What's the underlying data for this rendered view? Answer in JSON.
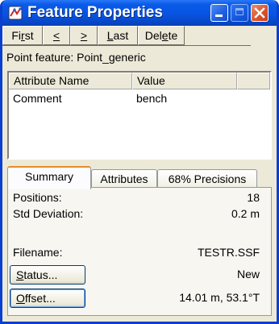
{
  "window": {
    "title": "Feature Properties",
    "icon": "feature-properties-app-icon",
    "controls": [
      "minimize-icon",
      "maximize-icon",
      "close-icon"
    ]
  },
  "nav": {
    "first": {
      "pre": "Fi",
      "key": "r",
      "post": "st"
    },
    "prev": {
      "pre": " ",
      "key": "<",
      "post": " "
    },
    "next": {
      "pre": " ",
      "key": ">",
      "post": " "
    },
    "last": {
      "pre": "",
      "key": "L",
      "post": "ast"
    },
    "delete": {
      "pre": "Del",
      "key": "e",
      "post": "te"
    }
  },
  "feature_label": "Point feature: Point_generic",
  "attributes": {
    "columns": [
      "Attribute Name",
      "Value"
    ],
    "rows": [
      {
        "name": "Comment",
        "value": "bench"
      }
    ]
  },
  "tabs": [
    "Summary",
    "Attributes",
    "68% Precisions"
  ],
  "summary": {
    "positions_label": "Positions:",
    "positions_value": "18",
    "std_label": "Std Deviation:",
    "std_value": "0.2 m",
    "filename_label": "Filename:",
    "filename_value": "TESTR.SSF",
    "status_button": {
      "key": "S",
      "rest": "tatus..."
    },
    "status_value": "New",
    "offset_button": {
      "key": "O",
      "rest": "ffset..."
    },
    "offset_value": "14.01 m, 53.1°T"
  },
  "colors": {
    "titlebar": "#0854e2",
    "close_button": "#d9522a",
    "active_tab_accent": "#e68b2c",
    "window_face": "#ece9d8"
  }
}
